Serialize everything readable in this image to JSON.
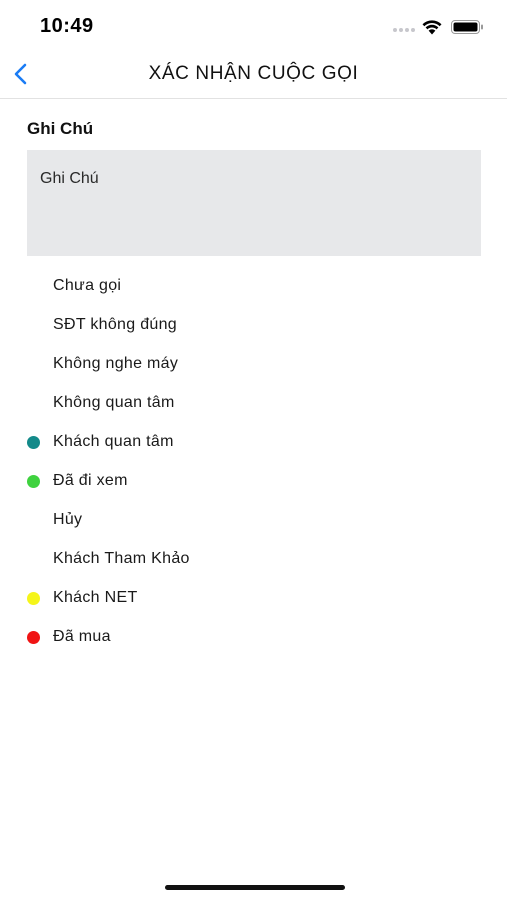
{
  "status_bar": {
    "time": "10:49",
    "icons": [
      "signal-dots-icon",
      "wifi-icon",
      "battery-icon"
    ]
  },
  "nav": {
    "back_icon": "chevron-left-icon",
    "title": "XÁC NHẬN CUỘC GỌI"
  },
  "note": {
    "label": "Ghi Chú",
    "placeholder": "Ghi Chú",
    "value": ""
  },
  "statuses": [
    {
      "label": "Chưa gọi",
      "dot_color": null
    },
    {
      "label": "SĐT không đúng",
      "dot_color": null
    },
    {
      "label": "Không nghe máy",
      "dot_color": null
    },
    {
      "label": "Không quan tâm",
      "dot_color": null
    },
    {
      "label": "Khách quan tâm",
      "dot_color": "#138a8a"
    },
    {
      "label": "Đã đi xem",
      "dot_color": "#3fd23f"
    },
    {
      "label": "Hủy",
      "dot_color": null
    },
    {
      "label": "Khách Tham Khảo",
      "dot_color": null
    },
    {
      "label": "Khách NET",
      "dot_color": "#f5f51a"
    },
    {
      "label": "Đã mua",
      "dot_color": "#f01414"
    }
  ],
  "colors": {
    "accent": "#1a7cf5",
    "note_background": "#e7e8ea"
  }
}
